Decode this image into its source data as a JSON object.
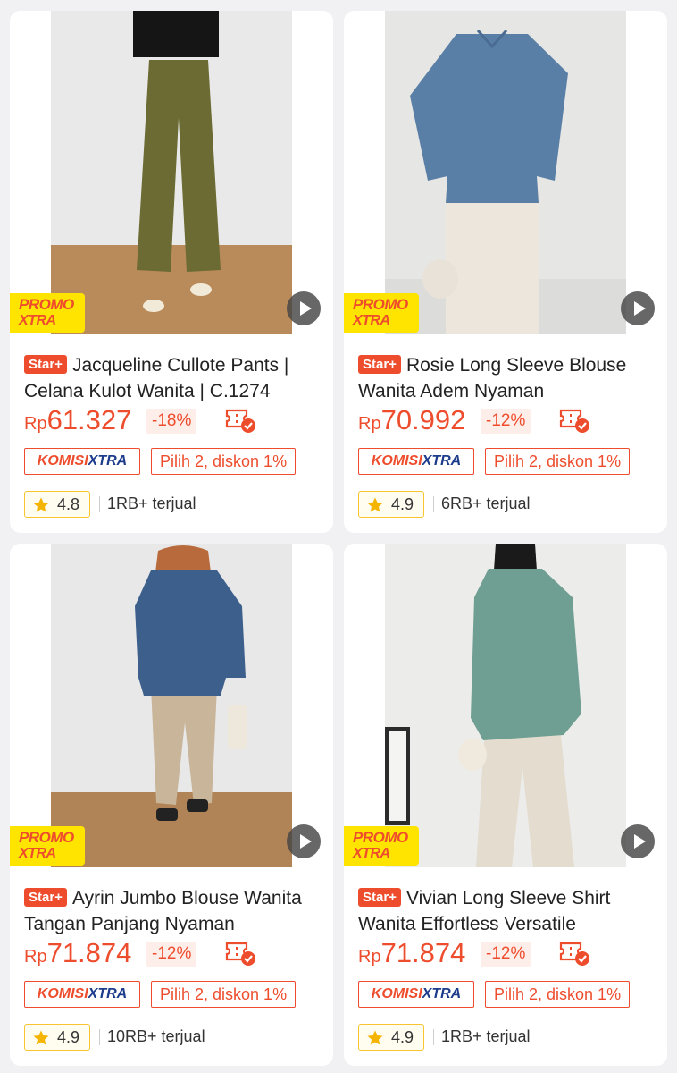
{
  "products": [
    {
      "badge": "Star+",
      "title": "Jacqueline Cullote Pants | Celana Kulot Wanita | C.1274",
      "currency": "Rp",
      "price": "61.327",
      "discount": "-18%",
      "komisi_a": "KOMISI",
      "komisi_b": "XTRA",
      "bundle": "Pilih 2, diskon 1%",
      "rating": "4.8",
      "sold": "1RB+ terjual",
      "promo_a": "PROMO",
      "promo_b": "XTRA",
      "colors": {
        "top": "#151515",
        "bottom": "#6b6b33",
        "bg": "#e9e9e9",
        "floor": "#b98a5a"
      }
    },
    {
      "badge": "Star+",
      "title": "Rosie Long Sleeve Blouse Wanita Adem Nyaman",
      "currency": "Rp",
      "price": "70.992",
      "discount": "-12%",
      "komisi_a": "KOMISI",
      "komisi_b": "XTRA",
      "bundle": "Pilih 2, diskon 1%",
      "rating": "4.9",
      "sold": "6RB+ terjual",
      "promo_a": "PROMO",
      "promo_b": "XTRA",
      "colors": {
        "top": "#5a7fa6",
        "bottom": "#ece6dc",
        "bg": "#e6e6e4",
        "floor": "#dcdcda"
      }
    },
    {
      "badge": "Star+",
      "title": "Ayrin Jumbo Blouse Wanita Tangan Panjang Nyaman",
      "currency": "Rp",
      "price": "71.874",
      "discount": "-12%",
      "komisi_a": "KOMISI",
      "komisi_b": "XTRA",
      "bundle": "Pilih 2, diskon 1%",
      "rating": "4.9",
      "sold": "10RB+ terjual",
      "promo_a": "PROMO",
      "promo_b": "XTRA",
      "colors": {
        "top": "#3d5f8c",
        "bottom": "#c9b59a",
        "bg": "#e8e8e8",
        "floor": "#b08457"
      }
    },
    {
      "badge": "Star+",
      "title": "Vivian Long Sleeve Shirt Wanita Effortless Versatile",
      "currency": "Rp",
      "price": "71.874",
      "discount": "-12%",
      "komisi_a": "KOMISI",
      "komisi_b": "XTRA",
      "bundle": "Pilih 2, diskon 1%",
      "rating": "4.9",
      "sold": "1RB+ terjual",
      "promo_a": "PROMO",
      "promo_b": "XTRA",
      "colors": {
        "top": "#6f9e92",
        "bottom": "#e3dccf",
        "bg": "#ececea",
        "floor": "#dcdad6"
      }
    }
  ]
}
